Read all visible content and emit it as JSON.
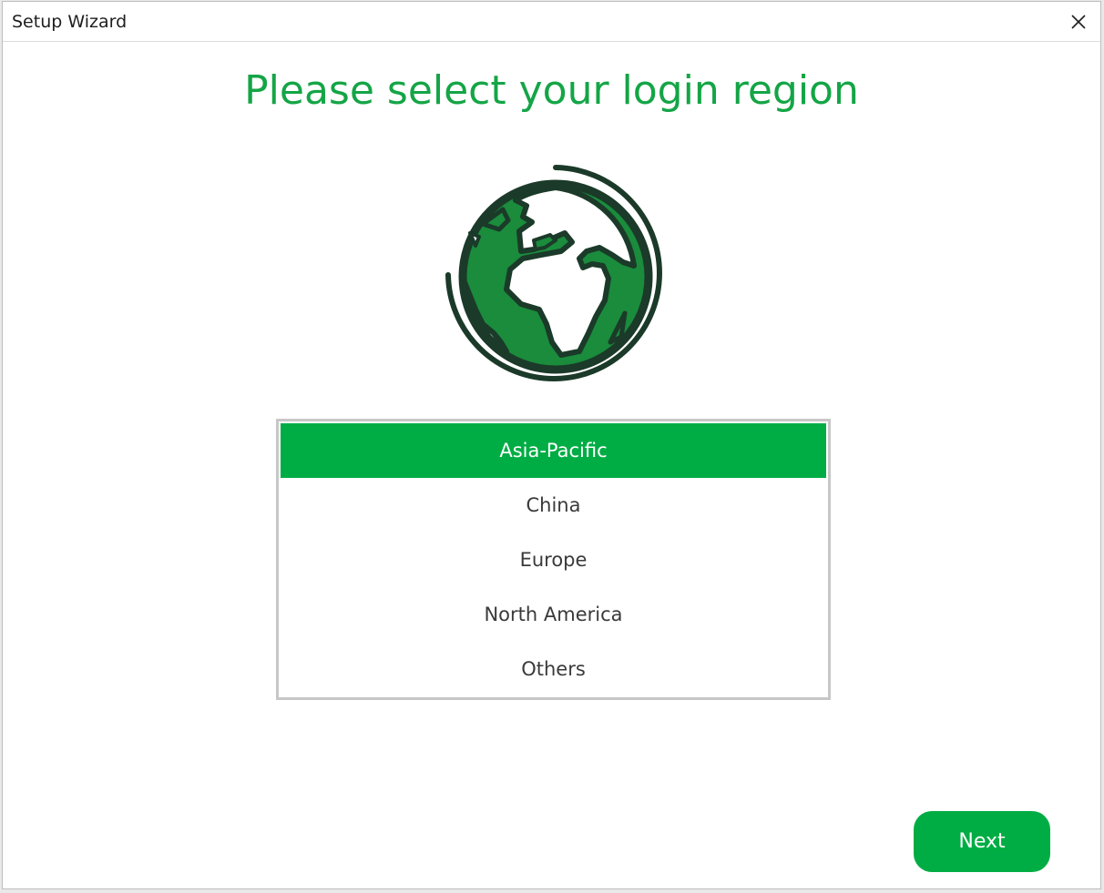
{
  "window": {
    "title": "Setup Wizard"
  },
  "main": {
    "heading": "Please select your login region",
    "regions": [
      {
        "label": "Asia-Pacific",
        "selected": true
      },
      {
        "label": "China",
        "selected": false
      },
      {
        "label": "Europe",
        "selected": false
      },
      {
        "label": "North America",
        "selected": false
      },
      {
        "label": "Others",
        "selected": false
      }
    ],
    "next_label": "Next"
  },
  "icons": {
    "close": "close-icon",
    "globe": "globe-icon"
  },
  "colors": {
    "accent": "#00ad44",
    "heading": "#14a546",
    "globe_fill": "#1a8c3c",
    "globe_outline": "#1b3a29"
  }
}
